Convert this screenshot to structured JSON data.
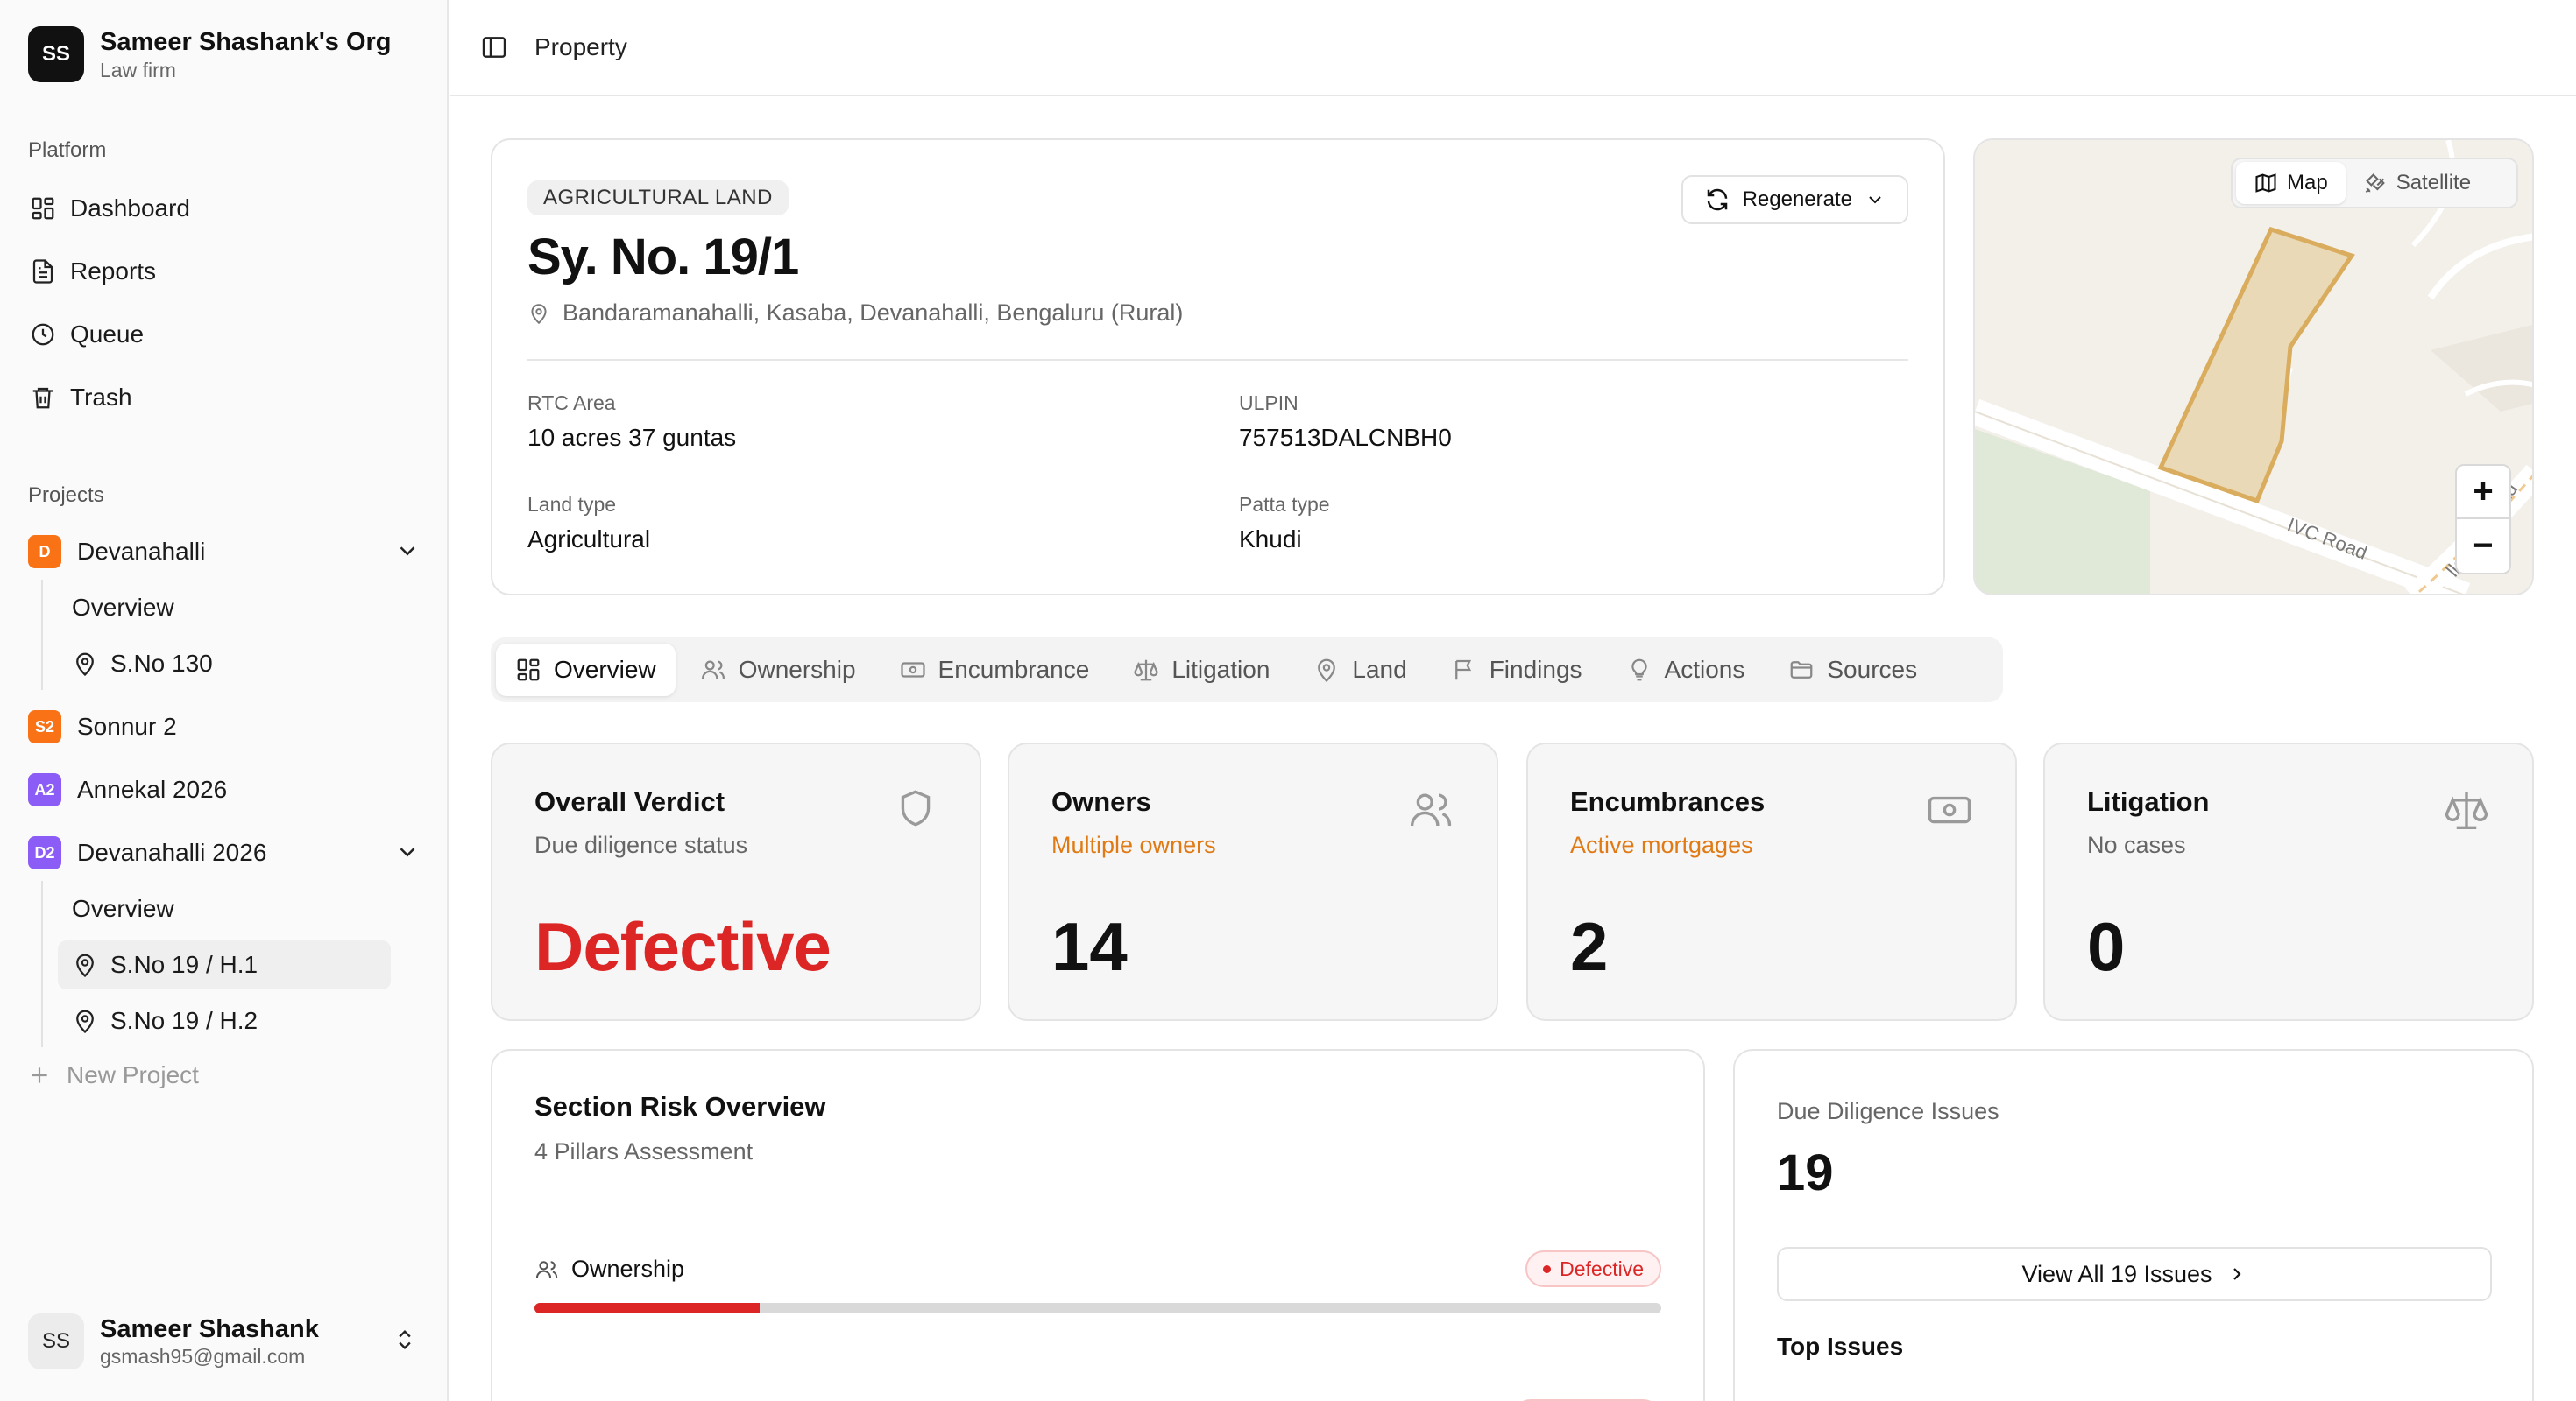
{
  "org": {
    "initials": "SS",
    "name": "Sameer Shashank's Org",
    "subtitle": "Law firm"
  },
  "sidebar": {
    "platform_label": "Platform",
    "platform_items": [
      {
        "label": "Dashboard",
        "icon": "dashboard-icon"
      },
      {
        "label": "Reports",
        "icon": "file-icon"
      },
      {
        "label": "Queue",
        "icon": "clock-icon"
      },
      {
        "label": "Trash",
        "icon": "trash-icon"
      }
    ],
    "projects_label": "Projects",
    "projects": [
      {
        "badge": "D",
        "badge_color": "#f97316",
        "label": "Devanahalli",
        "expanded": true,
        "children": [
          "Overview",
          "S.No 130"
        ]
      },
      {
        "badge": "S2",
        "badge_color": "#f97316",
        "label": "Sonnur 2"
      },
      {
        "badge": "A2",
        "badge_color": "#8b5cf6",
        "label": "Annekal 2026"
      },
      {
        "badge": "D2",
        "badge_color": "#8b5cf6",
        "label": "Devanahalli 2026",
        "expanded": true,
        "children": [
          "Overview",
          "S.No 19 / H.1",
          "S.No 19 / H.2"
        ]
      }
    ],
    "new_project": "New Project"
  },
  "user": {
    "initials": "SS",
    "name": "Sameer Shashank",
    "email": "gsmash95@gmail.com"
  },
  "header": {
    "title": "Property"
  },
  "property": {
    "tag": "AGRICULTURAL LAND",
    "title": "Sy. No. 19/1",
    "location": "Bandaramanahalli, Kasaba, Devanahalli, Bengaluru (Rural)",
    "regenerate_label": "Regenerate",
    "fields": {
      "rtc_area_label": "RTC Area",
      "rtc_area": "10 acres 37 guntas",
      "ulpin_label": "ULPIN",
      "ulpin": "757513DALCNBH0",
      "land_type_label": "Land type",
      "land_type": "Agricultural",
      "patta_type_label": "Patta type",
      "patta_type": "Khudi"
    }
  },
  "map": {
    "map_label": "Map",
    "satellite_label": "Satellite",
    "road_label": "IVC Road",
    "road_label_partial": "ad",
    "road_label_partial2": "lla",
    "zoom_in": "+",
    "zoom_out": "−"
  },
  "tabs": [
    "Overview",
    "Ownership",
    "Encumbrance",
    "Litigation",
    "Land",
    "Findings",
    "Actions",
    "Sources"
  ],
  "stats": {
    "verdict": {
      "title": "Overall Verdict",
      "subtitle": "Due diligence status",
      "value": "Defective",
      "color": "#dc2626"
    },
    "owners": {
      "title": "Owners",
      "subtitle": "Multiple owners",
      "value": "14"
    },
    "encumbrances": {
      "title": "Encumbrances",
      "subtitle": "Active mortgages",
      "value": "2"
    },
    "litigation": {
      "title": "Litigation",
      "subtitle": "No cases",
      "value": "0"
    }
  },
  "risk": {
    "title": "Section Risk Overview",
    "subtitle": "4 Pillars Assessment",
    "rows": [
      {
        "label": "Ownership",
        "status": "Defective",
        "progress": 0.2
      }
    ]
  },
  "issues": {
    "label": "Due Diligence Issues",
    "count": "19",
    "button": "View All 19 Issues",
    "top_label": "Top Issues"
  }
}
